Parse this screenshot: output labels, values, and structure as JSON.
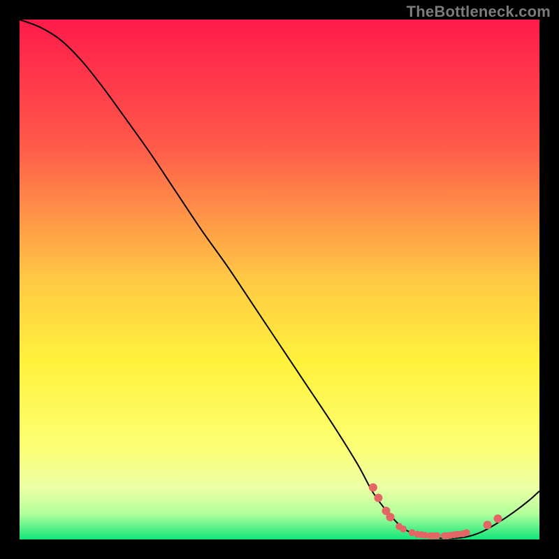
{
  "attribution": "TheBottleneck.com",
  "chart_data": {
    "type": "line",
    "title": "",
    "xlabel": "",
    "ylabel": "",
    "xlim": [
      0,
      100
    ],
    "ylim": [
      0,
      100
    ],
    "gradient_stops": [
      {
        "offset": 0,
        "color": "#ff1a4a"
      },
      {
        "offset": 24,
        "color": "#ff594a"
      },
      {
        "offset": 50,
        "color": "#ffc944"
      },
      {
        "offset": 66,
        "color": "#fff23c"
      },
      {
        "offset": 82,
        "color": "#fdff73"
      },
      {
        "offset": 90,
        "color": "#ecffa4"
      },
      {
        "offset": 95,
        "color": "#b4ff9c"
      },
      {
        "offset": 100,
        "color": "#11e67a"
      }
    ],
    "series": [
      {
        "name": "curve",
        "color": "#000000",
        "points": [
          {
            "x": 0,
            "y": 100
          },
          {
            "x": 4,
            "y": 98.5
          },
          {
            "x": 8,
            "y": 96.0
          },
          {
            "x": 12,
            "y": 92.0
          },
          {
            "x": 16,
            "y": 87.0
          },
          {
            "x": 20,
            "y": 81.5
          },
          {
            "x": 25,
            "y": 74.5
          },
          {
            "x": 30,
            "y": 67.0
          },
          {
            "x": 35,
            "y": 59.5
          },
          {
            "x": 40,
            "y": 52.5
          },
          {
            "x": 45,
            "y": 45.0
          },
          {
            "x": 50,
            "y": 37.5
          },
          {
            "x": 55,
            "y": 30.0
          },
          {
            "x": 60,
            "y": 22.5
          },
          {
            "x": 65,
            "y": 14.5
          },
          {
            "x": 68,
            "y": 9.0
          },
          {
            "x": 71,
            "y": 5.0
          },
          {
            "x": 74,
            "y": 2.0
          },
          {
            "x": 77,
            "y": 0.8
          },
          {
            "x": 80,
            "y": 0.3
          },
          {
            "x": 83,
            "y": 0.2
          },
          {
            "x": 86,
            "y": 0.5
          },
          {
            "x": 89,
            "y": 1.5
          },
          {
            "x": 92,
            "y": 3.2
          },
          {
            "x": 95,
            "y": 5.2
          },
          {
            "x": 98,
            "y": 7.5
          },
          {
            "x": 100,
            "y": 9.3
          }
        ]
      }
    ],
    "markers": [
      {
        "x": 68.0,
        "y": 10.0,
        "r": 6
      },
      {
        "x": 69.0,
        "y": 8.0,
        "r": 6
      },
      {
        "x": 70.5,
        "y": 5.5,
        "r": 6
      },
      {
        "x": 71.3,
        "y": 4.3,
        "r": 6
      },
      {
        "x": 73.0,
        "y": 2.5,
        "r": 5
      },
      {
        "x": 73.8,
        "y": 2.0,
        "r": 5
      },
      {
        "x": 75.5,
        "y": 1.3,
        "r": 5
      },
      {
        "x": 76.5,
        "y": 1.0,
        "r": 5
      },
      {
        "x": 77.3,
        "y": 0.9,
        "r": 5
      },
      {
        "x": 78.0,
        "y": 0.8,
        "r": 5
      },
      {
        "x": 79.0,
        "y": 0.7,
        "r": 5
      },
      {
        "x": 79.6,
        "y": 0.7,
        "r": 5
      },
      {
        "x": 80.3,
        "y": 0.7,
        "r": 5
      },
      {
        "x": 81.7,
        "y": 0.7,
        "r": 5
      },
      {
        "x": 82.3,
        "y": 0.7,
        "r": 5
      },
      {
        "x": 82.9,
        "y": 0.8,
        "r": 5
      },
      {
        "x": 83.6,
        "y": 0.9,
        "r": 5
      },
      {
        "x": 84.3,
        "y": 1.0,
        "r": 5
      },
      {
        "x": 85.3,
        "y": 1.1,
        "r": 5
      },
      {
        "x": 86.0,
        "y": 1.3,
        "r": 5
      },
      {
        "x": 90.0,
        "y": 2.8,
        "r": 6
      },
      {
        "x": 92.0,
        "y": 4.0,
        "r": 6
      }
    ],
    "marker_color": "#e46565"
  }
}
